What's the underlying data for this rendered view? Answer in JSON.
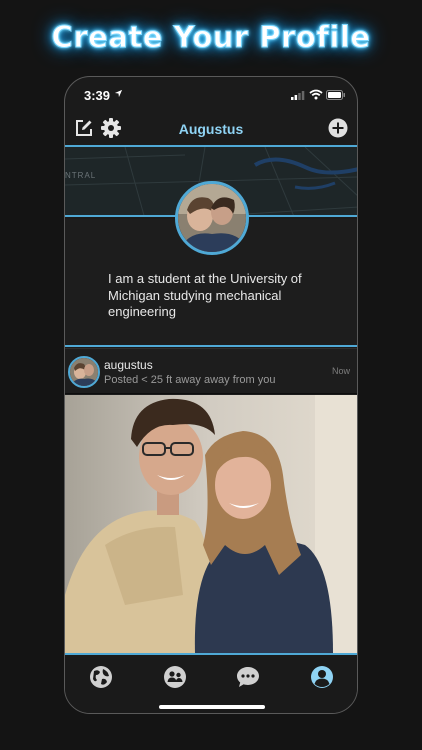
{
  "hero": {
    "title": "Create Your Profile"
  },
  "status_bar": {
    "time": "3:39"
  },
  "nav": {
    "title": "Augustus"
  },
  "map": {
    "label": "NTRAL"
  },
  "profile": {
    "bio": "I am a student at the University of Michigan studying mechanical engineering"
  },
  "post": {
    "username": "augustus",
    "location": "Posted < 25 ft away away from you",
    "time": "Now"
  },
  "tabs": [
    {
      "icon": "globe-icon"
    },
    {
      "icon": "people-icon"
    },
    {
      "icon": "chat-icon"
    },
    {
      "icon": "profile-icon",
      "active": true
    }
  ],
  "colors": {
    "accent": "#4fa9d6",
    "title_blue": "#8fd3f4",
    "background": "#141414"
  }
}
